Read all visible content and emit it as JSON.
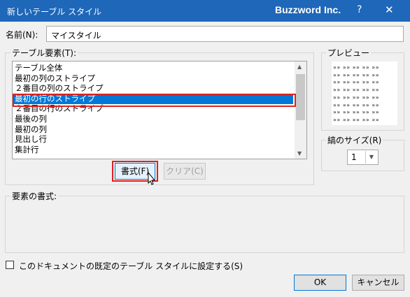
{
  "window": {
    "title": "新しいテーブル スタイル",
    "app": "Buzzword Inc.",
    "help": "?",
    "close": "✕"
  },
  "name_label": "名前(N):",
  "name_value": "マイスタイル",
  "table_elements_label": "テーブル要素(T):",
  "table_elements": [
    "テーブル全体",
    "最初の列のストライプ",
    "２番目の列のストライプ",
    "最初の行のストライプ",
    "２番目の行のストライプ",
    "最後の列",
    "最初の列",
    "見出し行",
    "集計行"
  ],
  "selected_index": 3,
  "format_button": "書式(F)",
  "clear_button": "クリア(C)",
  "preview_label": "プレビュー",
  "preview_rows": [
    "»» »» »» »» »»",
    "»» »» »» »» »»",
    "»» »» »» »» »»",
    "»» »» »» »» »»",
    "»» »» »» »» »»",
    "»» »» »» »» »»",
    "»» »» »» »» »»",
    "»» »» »» »» »»"
  ],
  "stripe_size_label": "縞のサイズ(R)",
  "stripe_size_value": "1",
  "element_format_label": "要素の書式:",
  "default_checkbox_label": "このドキュメントの既定のテーブル スタイルに設定する(S)",
  "default_checked": false,
  "ok_button": "OK",
  "cancel_button": "キャンセル",
  "icons": {
    "scroll_up": "scroll-up-icon",
    "scroll_down": "scroll-down-icon",
    "dropdown": "chevron-down-icon",
    "cursor": "mouse-pointer-icon"
  },
  "colors": {
    "titlebar": "#1e67b9",
    "selection": "#0078d7",
    "highlight": "#e0201b"
  }
}
